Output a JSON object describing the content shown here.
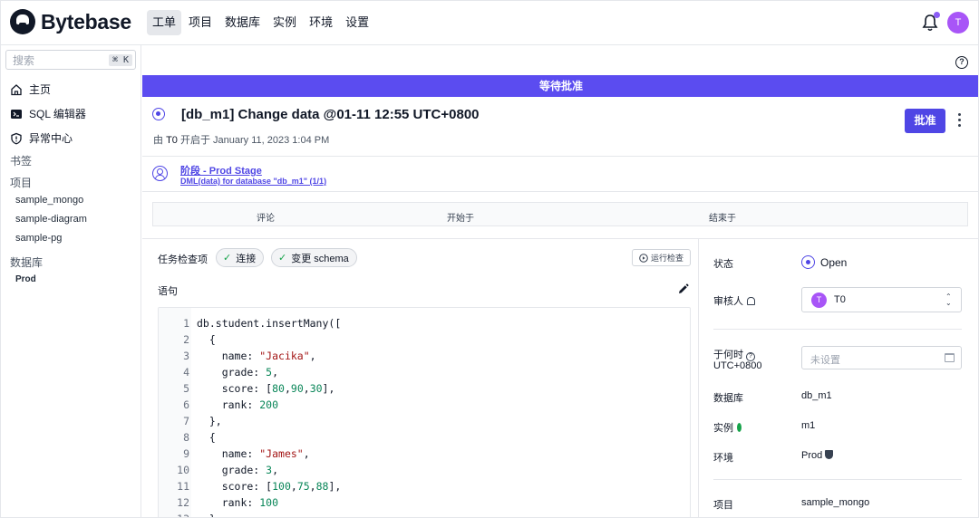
{
  "app": {
    "name": "Bytebase"
  },
  "nav": {
    "items": [
      "工单",
      "项目",
      "数据库",
      "实例",
      "环境",
      "设置"
    ],
    "active_index": 0
  },
  "header": {
    "avatar_initial": "T"
  },
  "sidebar": {
    "search_placeholder": "搜索",
    "shortcut": "⌘ K",
    "main_items": [
      "主页",
      "SQL 编辑器",
      "异常中心"
    ],
    "bookmarks_label": "书签",
    "projects_label": "项目",
    "projects": [
      "sample_mongo",
      "sample-diagram",
      "sample-pg"
    ],
    "databases_label": "数据库",
    "databases": [
      "Prod"
    ]
  },
  "issue": {
    "banner": "等待批准",
    "title": "[db_m1] Change data @01-11 12:55 UTC+0800",
    "by_prefix": "由",
    "author": "T0",
    "opened_text": "开启于 January 11, 2023 1:04 PM",
    "approve_label": "批准"
  },
  "stage": {
    "title": "阶段 - Prod Stage",
    "subtitle": "DML(data) for database \"db_m1\" (1/1)"
  },
  "task_table": {
    "columns": [
      "评论",
      "开始于",
      "结束于"
    ]
  },
  "checks": {
    "label": "任务检查项",
    "items": [
      "连接",
      "变更 schema"
    ],
    "run_label": "运行检查"
  },
  "statement": {
    "label": "语句",
    "lines": [
      [
        {
          "t": "db.student.insertMany(["
        }
      ],
      [
        {
          "t": "  {"
        }
      ],
      [
        {
          "t": "    name: "
        },
        {
          "t": "\"Jacika\"",
          "c": "str"
        },
        {
          "t": ","
        }
      ],
      [
        {
          "t": "    grade: "
        },
        {
          "t": "5",
          "c": "num"
        },
        {
          "t": ","
        }
      ],
      [
        {
          "t": "    score: ["
        },
        {
          "t": "80",
          "c": "num"
        },
        {
          "t": ","
        },
        {
          "t": "90",
          "c": "num"
        },
        {
          "t": ","
        },
        {
          "t": "30",
          "c": "num"
        },
        {
          "t": "],"
        }
      ],
      [
        {
          "t": "    rank: "
        },
        {
          "t": "200",
          "c": "num"
        }
      ],
      [
        {
          "t": "  },"
        }
      ],
      [
        {
          "t": "  {"
        }
      ],
      [
        {
          "t": "    name: "
        },
        {
          "t": "\"James\"",
          "c": "str"
        },
        {
          "t": ","
        }
      ],
      [
        {
          "t": "    grade: "
        },
        {
          "t": "3",
          "c": "num"
        },
        {
          "t": ","
        }
      ],
      [
        {
          "t": "    score: ["
        },
        {
          "t": "100",
          "c": "num"
        },
        {
          "t": ","
        },
        {
          "t": "75",
          "c": "num"
        },
        {
          "t": ","
        },
        {
          "t": "88",
          "c": "num"
        },
        {
          "t": "],"
        }
      ],
      [
        {
          "t": "    rank: "
        },
        {
          "t": "100",
          "c": "num"
        }
      ],
      [
        {
          "t": "  }"
        }
      ]
    ]
  },
  "details": {
    "status_label": "状态",
    "status_value": "Open",
    "reviewer_label": "审核人",
    "reviewer_initial": "T",
    "reviewer_name": "T0",
    "when_label": "于何时",
    "timezone": "UTC+0800",
    "when_placeholder": "未设置",
    "database_label": "数据库",
    "database_value": "db_m1",
    "instance_label": "实例",
    "instance_value": "m1",
    "environment_label": "环境",
    "environment_value": "Prod",
    "project_label": "项目",
    "project_value": "sample_mongo"
  },
  "colors": {
    "accent": "#4f46e5",
    "banner": "#5b4cf0",
    "avatar": "#a855f7",
    "string": "#a31515",
    "number": "#098658",
    "success": "#16a34a"
  }
}
